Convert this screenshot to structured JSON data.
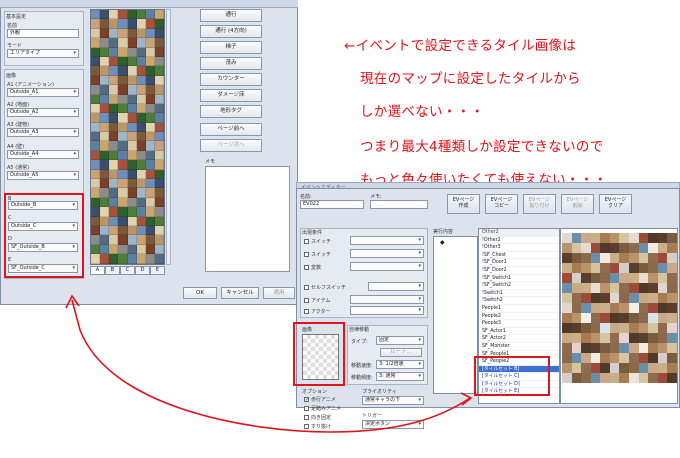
{
  "annotation": {
    "lines": [
      "←イベントで設定できるタイル画像は",
      "現在のマップに設定したタイルから",
      "しか選べない・・・",
      "つまり最大4種類しか設定できないので",
      "もっと色々使いたくても使えない・・・"
    ],
    "color": "#e0141b"
  },
  "tileset_window": {
    "basic_group_label": "基本設定",
    "name_label": "名前",
    "name_value": "外観",
    "mode_label": "モード",
    "mode_value": "エリアタイプ",
    "images_group_label": "画像",
    "a1_label": "A1 (アニメーション)",
    "a1_value": "Outside_A1",
    "a2_label": "A2 (地面)",
    "a2_value": "Outside_A2",
    "a3_label": "A3 (建物)",
    "a3_value": "Outside_A3",
    "a4_label": "A4 (壁)",
    "a4_value": "Outside_A4",
    "a5_label": "A5 (通常)",
    "a5_value": "Outside_A5",
    "b_label": "B",
    "b_value": "Outside_B",
    "c_label": "C",
    "c_value": "Outside_C",
    "d_label": "D",
    "d_value": "SF_Outside_B",
    "e_label": "E",
    "e_value": "SF_Outside_C",
    "tabs": [
      "A",
      "B",
      "C",
      "D",
      "E"
    ],
    "side_buttons": [
      "通行",
      "通行 (4方向)",
      "梯子",
      "茂み",
      "カウンター",
      "ダメージ床",
      "地形タグ"
    ],
    "page_buttons": [
      "ページ前へ",
      "ページ次へ"
    ],
    "note_label": "メモ",
    "ok_label": "OK",
    "cancel_label": "キャンセル",
    "apply_label": "適用",
    "palette_colors": [
      "#6f8fb8",
      "#c9a66b",
      "#7a5a3a",
      "#4e7d3a",
      "#9fb6c9",
      "#a6513a",
      "#d8c9a8",
      "#3b4e6b",
      "#8c8c8c",
      "#b89868",
      "#5d7fa1",
      "#caa27a",
      "#2f5e2f",
      "#7b3f2a",
      "#e2d3b0",
      "#556b7f"
    ]
  },
  "event_window": {
    "title": "イベントエディター",
    "name_label": "名前:",
    "name_value": "EV022",
    "note_label": "メモ:",
    "page_buttons": [
      "EVページ\n作成",
      "EVページ\nコピー",
      "EVページ\n貼り付け",
      "EVページ\n削除",
      "EVページ\nクリア"
    ],
    "conditions_label": "出現条件",
    "cond_switch1": "スイッチ",
    "cond_switch2": "スイッチ",
    "cond_variable": "変数",
    "cond_selfswitch": "セルフスイッチ",
    "cond_item": "アイテム",
    "cond_actor": "アクター",
    "image_label": "画像",
    "autonomous_label": "自律移動",
    "type_label": "タイプ:",
    "type_value": "固定",
    "route_label": "ルート...",
    "speed_label": "移動速度:",
    "speed_value": "3: 1/2倍速",
    "freq_label": "移動頻度:",
    "freq_value": "3: 通常",
    "options_label": "オプション",
    "opt_walk": "歩行アニメ",
    "opt_step": "足踏みアニメ",
    "opt_dir": "向き固定",
    "opt_through": "すり抜け",
    "priority_label": "プライオリティ",
    "priority_value": "通常キャラの下",
    "trigger_label": "トリガー",
    "trigger_value": "決定ボタン",
    "commands_label": "実行内容",
    "tab_label": "Other2",
    "list_items": [
      "!Other2",
      "!Other3",
      "!SF_Chest",
      "!SF_Door1",
      "!SF_Door2",
      "!SF_Switch1",
      "!SF_Switch2",
      "!Switch1",
      "!Switch2",
      "People1",
      "People2",
      "People3",
      "SF_Actor1",
      "SF_Actor2",
      "SF_Monster",
      "SF_People1",
      "SF_People2",
      "[タイルセット B]",
      "[タイルセット C]",
      "[タイルセット D]",
      "[タイルセット E]"
    ],
    "preview_colors": [
      "#8a6a4a",
      "#b9946a",
      "#5a3d2a",
      "#c9b08a",
      "#9e4a36",
      "#6b8fa9",
      "#d6c3a0",
      "#7a5d3e",
      "#a87c52",
      "#4f3a2a",
      "#caa98a",
      "#8f6b4f"
    ]
  }
}
